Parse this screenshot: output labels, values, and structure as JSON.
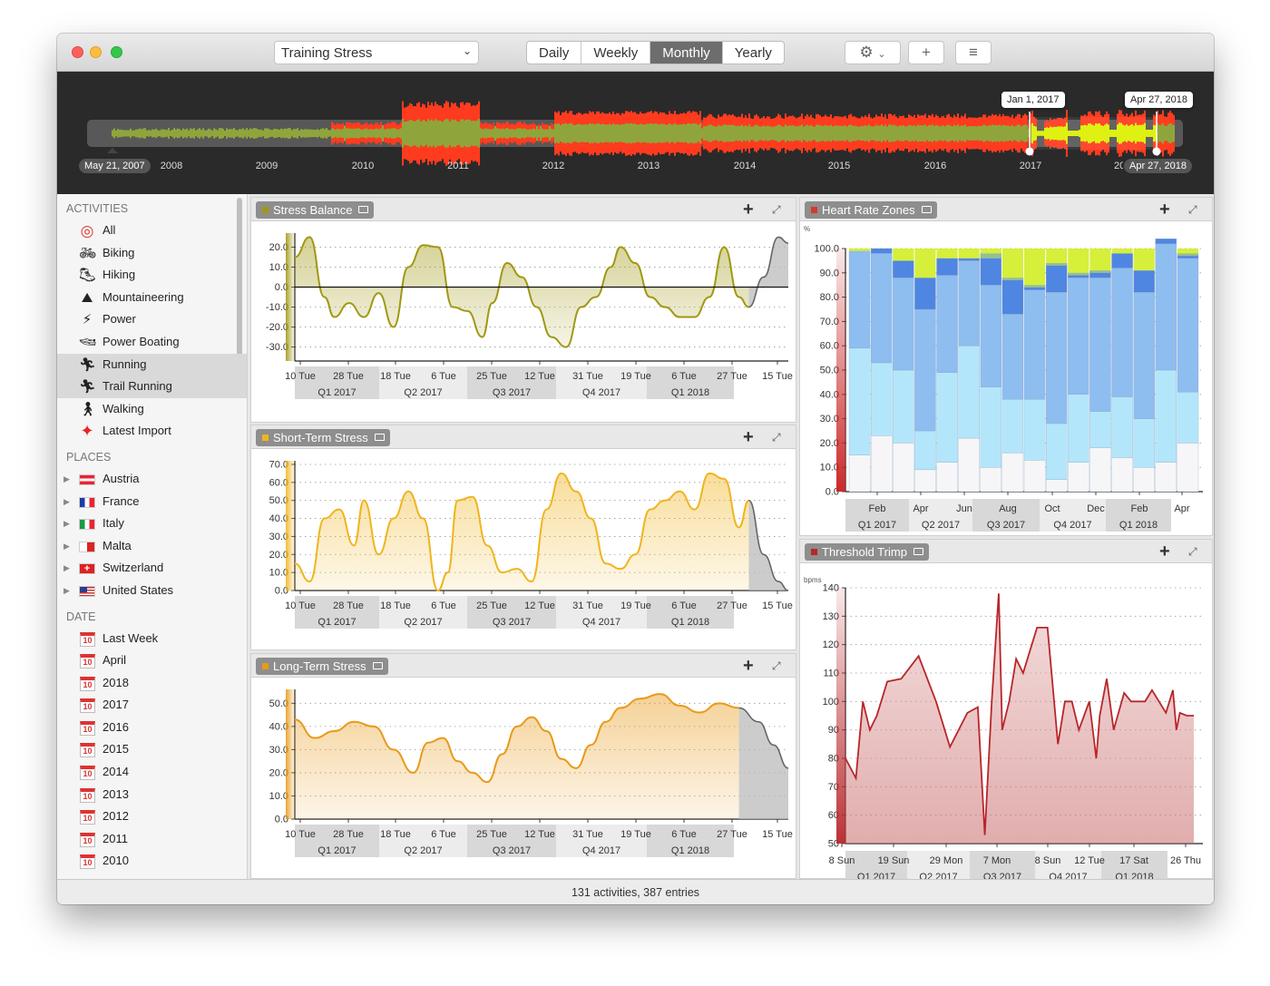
{
  "toolbar": {
    "metric": "Training Stress",
    "periods": [
      "Daily",
      "Weekly",
      "Monthly",
      "Yearly"
    ],
    "active_period": "Monthly",
    "gear": "gear-icon",
    "add": "+",
    "list": "list-icon"
  },
  "timeline": {
    "start_label": "May 21, 2007",
    "end_label": "Apr 27, 2018",
    "years": [
      "2008",
      "2009",
      "2010",
      "2011",
      "2012",
      "2013",
      "2014",
      "2015",
      "2016",
      "2017",
      "2018"
    ],
    "selection": {
      "from": "Jan 1, 2017",
      "to": "Apr 27, 2018"
    },
    "colors": {
      "high": "#ff3b1f",
      "low": "#8fa53c",
      "selected": "#dcf000"
    }
  },
  "sidebar": {
    "activities_header": "ACTIVITIES",
    "activities": [
      {
        "label": "All",
        "icon": "target-icon"
      },
      {
        "label": "Biking",
        "icon": "bike-icon"
      },
      {
        "label": "Hiking",
        "icon": "hiking-icon"
      },
      {
        "label": "Mountaineering",
        "icon": "mountaineering-icon"
      },
      {
        "label": "Power",
        "icon": "power-icon"
      },
      {
        "label": "Power Boating",
        "icon": "boat-icon"
      },
      {
        "label": "Running",
        "icon": "running-icon"
      },
      {
        "label": "Trail Running",
        "icon": "trail-running-icon"
      },
      {
        "label": "Walking",
        "icon": "walking-icon"
      },
      {
        "label": "Latest Import",
        "icon": "star-icon"
      }
    ],
    "places_header": "PLACES",
    "places": [
      {
        "label": "Austria"
      },
      {
        "label": "France"
      },
      {
        "label": "Italy"
      },
      {
        "label": "Malta"
      },
      {
        "label": "Switzerland"
      },
      {
        "label": "United States"
      }
    ],
    "date_header": "DATE",
    "dates": [
      {
        "label": "Last Week"
      },
      {
        "label": "April"
      },
      {
        "label": "2018"
      },
      {
        "label": "2017"
      },
      {
        "label": "2016"
      },
      {
        "label": "2015"
      },
      {
        "label": "2014"
      },
      {
        "label": "2013"
      },
      {
        "label": "2012"
      },
      {
        "label": "2011"
      },
      {
        "label": "2010"
      }
    ],
    "calendar_day": "10"
  },
  "panels": {
    "stress_balance": {
      "title": "Stress Balance",
      "color": "#a09812"
    },
    "short_term": {
      "title": "Short-Term Stress",
      "color": "#f0b41e"
    },
    "long_term": {
      "title": "Long-Term Stress",
      "color": "#e89a18"
    },
    "hr_zones": {
      "title": "Heart Rate Zones",
      "color": "#d43a2a"
    },
    "trimp": {
      "title": "Threshold Trimp",
      "color": "#b8262a"
    },
    "add": "+",
    "expand": "expand-icon"
  },
  "chart_data": [
    {
      "type": "area",
      "title": "Stress Balance",
      "ylim": [
        -37,
        27
      ],
      "yticks": [
        "20.0",
        "10.0",
        "0.0",
        "-10.0",
        "-20.0",
        "-30.0"
      ],
      "xticks": [
        "10 Tue",
        "28 Tue",
        "18 Tue",
        "6 Tue",
        "25 Tue",
        "12 Tue",
        "31 Tue",
        "19 Tue",
        "6 Tue",
        "27 Tue",
        "15 Tue"
      ],
      "quarters": [
        "Q1 2017",
        "Q2 2017",
        "Q3 2017",
        "Q4 2017",
        "Q1 2018"
      ],
      "x": [
        0,
        3,
        6,
        8,
        11,
        14,
        17,
        20,
        23,
        26,
        29,
        32,
        35,
        38,
        40,
        43,
        46,
        49,
        52,
        55,
        58,
        61,
        64,
        66,
        69,
        72,
        75,
        78,
        81,
        84,
        87,
        90,
        92,
        95,
        98,
        100
      ],
      "values": [
        15,
        25,
        -5,
        -15,
        -8,
        -15,
        -3,
        -20,
        10,
        21,
        20,
        -10,
        -12,
        -25,
        -8,
        12,
        5,
        -10,
        -25,
        -30,
        -10,
        -5,
        10,
        20,
        12,
        -5,
        -10,
        -15,
        -15,
        -5,
        20,
        -5,
        -10,
        5,
        25,
        22
      ]
    },
    {
      "type": "area",
      "title": "Short-Term Stress",
      "ylim": [
        0,
        72
      ],
      "yticks": [
        "70.0",
        "60.0",
        "50.0",
        "40.0",
        "30.0",
        "20.0",
        "10.0",
        "0.0"
      ],
      "xticks": [
        "10 Tue",
        "28 Tue",
        "18 Tue",
        "6 Tue",
        "25 Tue",
        "12 Tue",
        "31 Tue",
        "19 Tue",
        "6 Tue",
        "27 Tue",
        "15 Tue"
      ],
      "quarters": [
        "Q1 2017",
        "Q2 2017",
        "Q3 2017",
        "Q4 2017",
        "Q1 2018"
      ],
      "x": [
        0,
        3,
        6,
        9,
        12,
        14,
        17,
        20,
        23,
        26,
        29,
        31,
        33,
        36,
        39,
        42,
        45,
        48,
        51,
        54,
        57,
        60,
        63,
        66,
        69,
        72,
        75,
        78,
        81,
        84,
        87,
        90,
        92,
        95,
        98,
        100
      ],
      "values": [
        15,
        5,
        40,
        45,
        25,
        50,
        20,
        40,
        55,
        40,
        0,
        10,
        50,
        52,
        25,
        10,
        12,
        5,
        45,
        65,
        55,
        40,
        15,
        12,
        20,
        45,
        50,
        55,
        45,
        65,
        62,
        35,
        50,
        20,
        5,
        0
      ]
    },
    {
      "type": "area",
      "title": "Long-Term Stress",
      "ylim": [
        0,
        56
      ],
      "yticks": [
        "50.0",
        "40.0",
        "30.0",
        "20.0",
        "10.0",
        "0.0"
      ],
      "xticks": [
        "10 Tue",
        "28 Tue",
        "18 Tue",
        "6 Tue",
        "25 Tue",
        "12 Tue",
        "31 Tue",
        "19 Tue",
        "6 Tue",
        "27 Tue",
        "15 Tue"
      ],
      "quarters": [
        "Q1 2017",
        "Q2 2017",
        "Q3 2017",
        "Q4 2017",
        "Q1 2018"
      ],
      "x": [
        0,
        4,
        8,
        12,
        16,
        20,
        24,
        27,
        30,
        33,
        36,
        39,
        42,
        45,
        48,
        51,
        54,
        57,
        60,
        63,
        66,
        70,
        74,
        78,
        82,
        86,
        90,
        94,
        97,
        100
      ],
      "values": [
        43,
        35,
        38,
        42,
        40,
        30,
        20,
        33,
        35,
        25,
        20,
        16,
        28,
        40,
        44,
        38,
        26,
        22,
        32,
        42,
        48,
        52,
        54,
        49,
        46,
        50,
        48,
        42,
        32,
        22
      ]
    },
    {
      "type": "bar",
      "title": "Heart Rate Zones",
      "ylabel": "%",
      "ylim": [
        0,
        100
      ],
      "yticks": [
        "100.0",
        "90.0",
        "80.0",
        "70.0",
        "60.0",
        "50.0",
        "40.0",
        "30.0",
        "20.0",
        "10.0",
        "0.0"
      ],
      "xticks": [
        "Feb",
        "Apr",
        "Jun",
        "Aug",
        "Oct",
        "Dec",
        "Feb",
        "Apr"
      ],
      "quarters": [
        "Q1 2017",
        "Q2 2017",
        "Q3 2017",
        "Q4 2017",
        "Q1 2018"
      ],
      "series": [
        {
          "values": [
            15,
            23,
            20,
            9,
            12,
            22,
            10,
            16,
            13,
            5,
            12,
            18,
            14,
            10,
            12,
            20
          ]
        },
        {
          "values": [
            44,
            30,
            30,
            16,
            37,
            38,
            33,
            22,
            25,
            23,
            28,
            15,
            25,
            20,
            38,
            21
          ]
        },
        {
          "values": [
            40,
            45,
            38,
            50,
            40,
            35,
            42,
            35,
            45,
            54,
            48,
            55,
            53,
            52,
            52,
            55
          ]
        },
        {
          "values": [
            0,
            2,
            7,
            13,
            7,
            1,
            11,
            14,
            1,
            11,
            1,
            2,
            6,
            9,
            2,
            1
          ]
        },
        {
          "values": [
            0,
            0,
            0,
            0,
            0,
            0,
            2,
            1,
            1,
            1,
            1,
            1,
            0,
            0,
            0,
            1
          ]
        }
      ],
      "colors": [
        "#f6f6f8",
        "#b4e6fb",
        "#8ebdf0",
        "#4f86e1",
        "#95c08f",
        "#d5ef3b"
      ]
    },
    {
      "type": "line",
      "title": "Threshold Trimp",
      "ylabel": "bpms",
      "ylim": [
        50,
        140
      ],
      "yticks": [
        "140",
        "130",
        "120",
        "110",
        "100",
        "90",
        "80",
        "70",
        "60",
        "50"
      ],
      "xticks": [
        "8 Sun",
        "19 Sun",
        "29 Mon",
        "7 Mon",
        "8 Sun",
        "12 Tue",
        "17 Sat",
        "26 Thu"
      ],
      "quarters": [
        "Q1 2017",
        "Q2 2017",
        "Q3 2017",
        "Q4 2017",
        "Q1 2018"
      ],
      "x": [
        0,
        3,
        5,
        7,
        9,
        12,
        16,
        21,
        26,
        30,
        35,
        38,
        40,
        42,
        44,
        45,
        47,
        49,
        51,
        55,
        58,
        61,
        63,
        65,
        67,
        70,
        72,
        73,
        75,
        77,
        80,
        82,
        84,
        86,
        88,
        90,
        92,
        94,
        95,
        96,
        98,
        100
      ],
      "values": [
        80,
        73,
        100,
        90,
        95,
        107,
        108,
        116,
        100,
        84,
        96,
        98,
        53,
        100,
        138,
        90,
        100,
        115,
        110,
        126,
        126,
        85,
        100,
        100,
        90,
        100,
        80,
        95,
        108,
        90,
        103,
        100,
        100,
        100,
        104,
        100,
        96,
        104,
        90,
        96,
        95,
        95
      ]
    }
  ],
  "status": "131 activities, 387 entries"
}
